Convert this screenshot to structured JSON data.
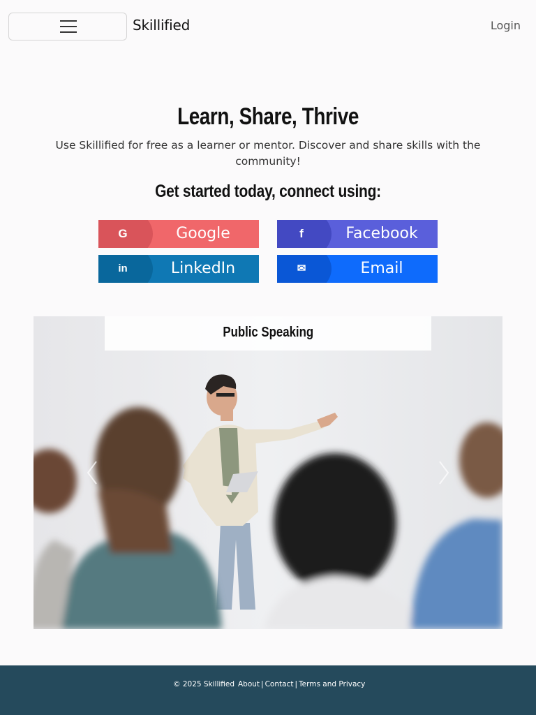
{
  "header": {
    "brand": "Skillified",
    "login": "Login"
  },
  "hero": {
    "title": "Learn, Share, Thrive",
    "subtitle": "Use Skillified for free as a learner or mentor. Discover and share skills with the community!",
    "cta": "Get started today, connect using:"
  },
  "social": [
    {
      "label": "Google",
      "icon": "google-icon",
      "glyph": "G",
      "color": "#f0676a"
    },
    {
      "label": "Facebook",
      "icon": "facebook-icon",
      "glyph": "f",
      "color": "#5a5fdb"
    },
    {
      "label": "LinkedIn",
      "icon": "linkedin-icon",
      "glyph": "in",
      "color": "#0f78b4"
    },
    {
      "label": "Email",
      "icon": "envelope-icon",
      "glyph": "✉",
      "color": "#0e6bfc"
    }
  ],
  "carousel": {
    "caption": "Public Speaking"
  },
  "footer": {
    "copyright": "© 2025 Skillified",
    "links": [
      "About",
      "Contact",
      "Terms and Privacy"
    ],
    "background": "#254a5c"
  }
}
